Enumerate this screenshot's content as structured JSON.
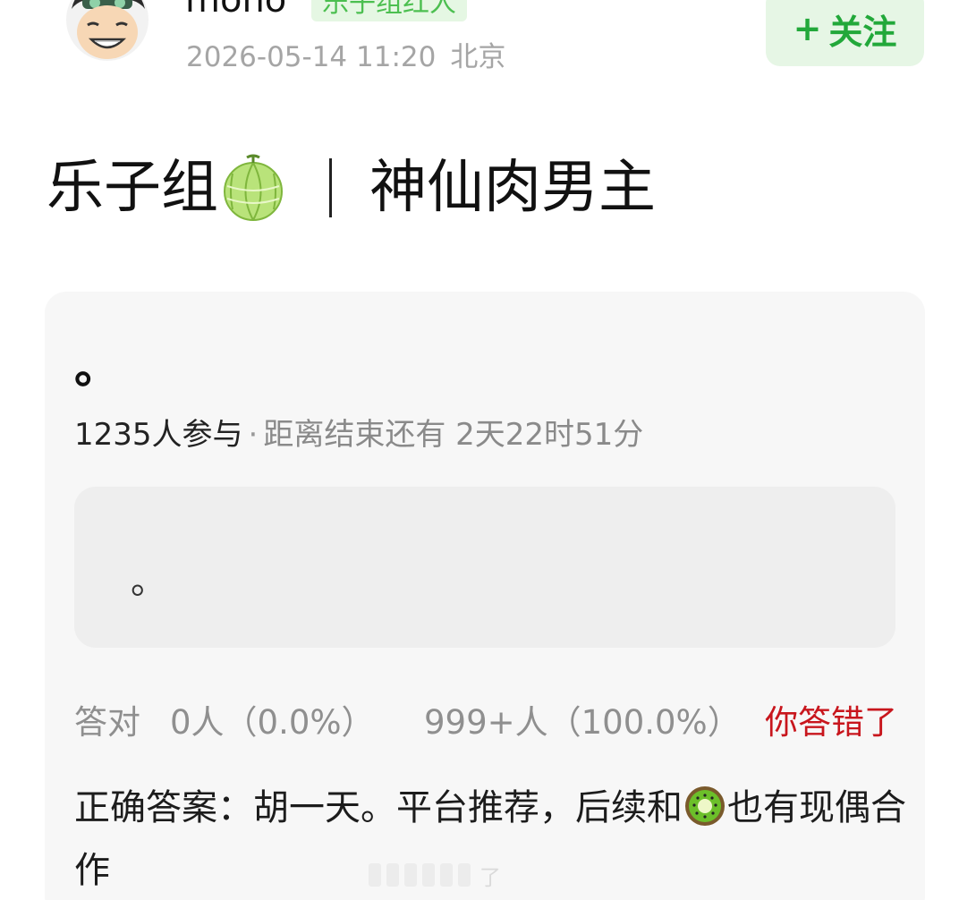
{
  "header": {
    "username": "mono",
    "badge": "乐子组红人",
    "date": "2026-05-14 11:20",
    "location": "北京",
    "follow": {
      "plus": "+",
      "label": "关注"
    }
  },
  "title": {
    "prefix": "乐子组",
    "melon_icon": "melon-emoji",
    "main": "神仙肉男主"
  },
  "quiz": {
    "question": "。",
    "participants": "1235人参与",
    "separator": "·",
    "remaining": "距离结束还有 2天22时51分",
    "option": "。",
    "result": {
      "correct_label": "答对",
      "correct_value": "0人（0.0%）",
      "wrong_value": "999+人（100.0%）",
      "mine": "你答错了"
    },
    "answer": {
      "before_icon": "正确答案：胡一天。平台推荐，后续和",
      "icon": "kiwi-emoji",
      "after_icon": "也有现偶合作"
    }
  },
  "watermark": "了",
  "colors": {
    "follow_green": "#22a83a",
    "badge_green": "#4cbf50",
    "wrong_red": "#c8161d",
    "card_bg": "#f7f7f7"
  }
}
